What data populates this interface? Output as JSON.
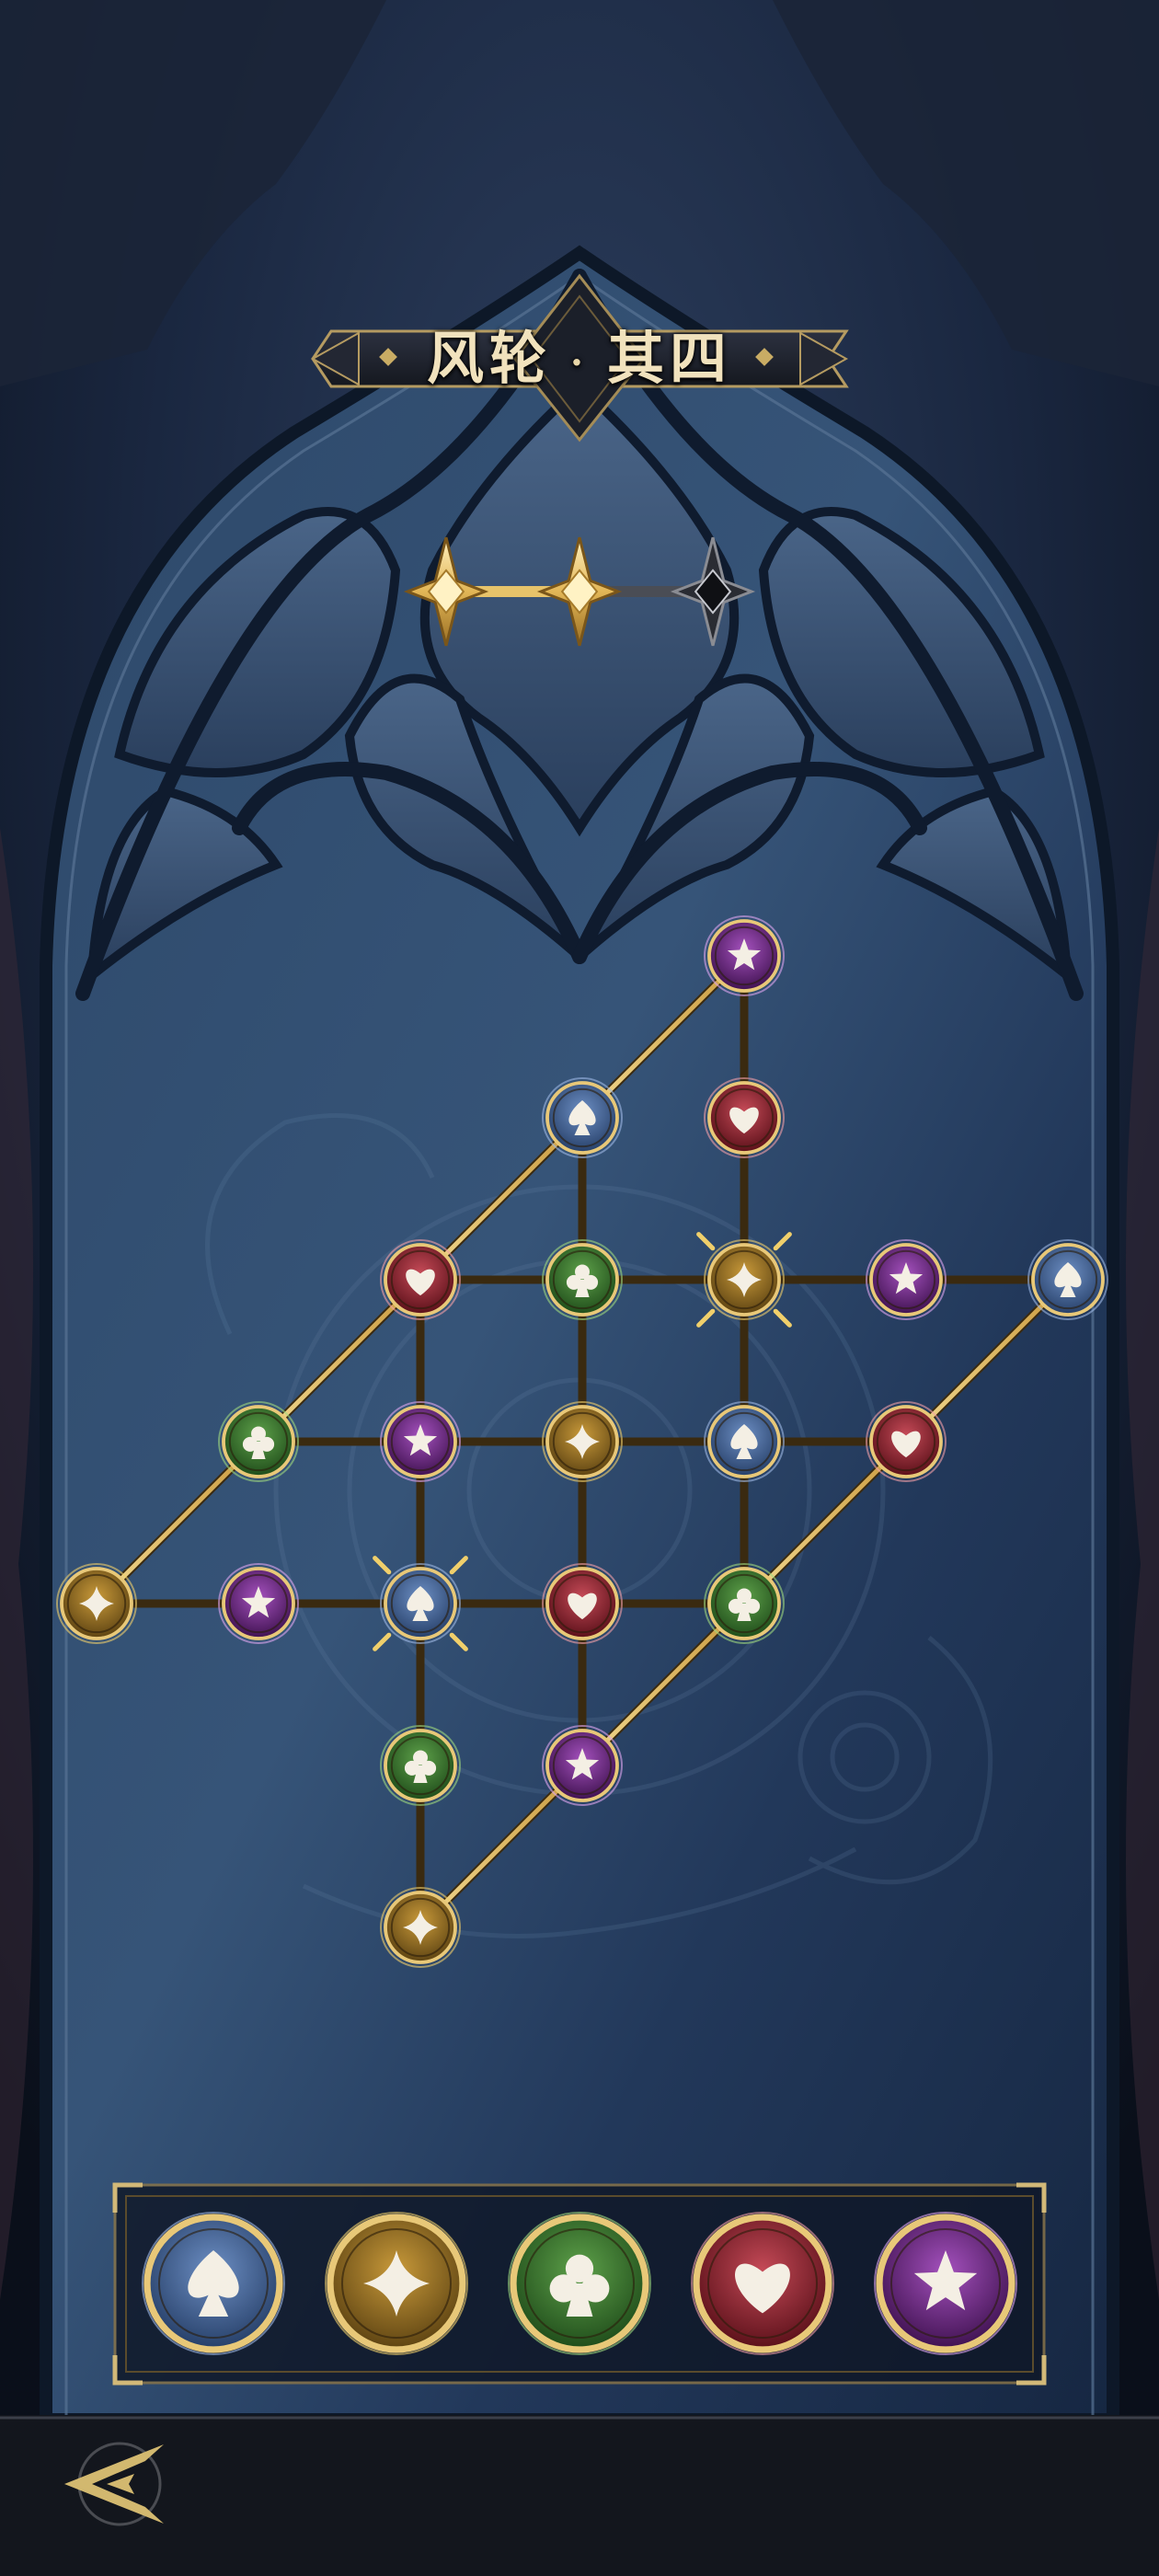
{
  "stage": {
    "title_main": "风轮",
    "title_sub": "其四",
    "title_separator": "·",
    "stars": {
      "total": 3,
      "earned": 2
    }
  },
  "suits": {
    "spade": {
      "icon": "spade-icon",
      "color": "#3b5d8f",
      "glow": "#9fb9e6"
    },
    "diamond": {
      "icon": "diamond-star-icon",
      "color": "#8e6a1b",
      "glow": "#f0cf6b"
    },
    "club": {
      "icon": "club-icon",
      "color": "#2f6a26",
      "glow": "#9fd87f"
    },
    "heart": {
      "icon": "heart-icon",
      "color": "#8f2230",
      "glow": "#f3a0a8"
    },
    "star": {
      "icon": "star-icon",
      "color": "#6a2580",
      "glow": "#e0a6f2"
    }
  },
  "grid": {
    "nodes": [
      {
        "id": "n1",
        "col": 4,
        "row": 0,
        "suit": "star"
      },
      {
        "id": "n2",
        "col": 3,
        "row": 1,
        "suit": "spade"
      },
      {
        "id": "n3",
        "col": 4,
        "row": 1,
        "suit": "heart"
      },
      {
        "id": "n4",
        "col": 2,
        "row": 2,
        "suit": "heart"
      },
      {
        "id": "n5",
        "col": 3,
        "row": 2,
        "suit": "club"
      },
      {
        "id": "n6",
        "col": 4,
        "row": 2,
        "suit": "diamond",
        "marked": true
      },
      {
        "id": "n7",
        "col": 5,
        "row": 2,
        "suit": "star"
      },
      {
        "id": "n8",
        "col": 6,
        "row": 2,
        "suit": "spade"
      },
      {
        "id": "n9",
        "col": 1,
        "row": 3,
        "suit": "club"
      },
      {
        "id": "n10",
        "col": 2,
        "row": 3,
        "suit": "star"
      },
      {
        "id": "n11",
        "col": 3,
        "row": 3,
        "suit": "diamond"
      },
      {
        "id": "n12",
        "col": 4,
        "row": 3,
        "suit": "spade"
      },
      {
        "id": "n13",
        "col": 5,
        "row": 3,
        "suit": "heart"
      },
      {
        "id": "n14",
        "col": 0,
        "row": 4,
        "suit": "diamond"
      },
      {
        "id": "n15",
        "col": 1,
        "row": 4,
        "suit": "star"
      },
      {
        "id": "n16",
        "col": 2,
        "row": 4,
        "suit": "spade",
        "marked": true
      },
      {
        "id": "n17",
        "col": 3,
        "row": 4,
        "suit": "heart"
      },
      {
        "id": "n18",
        "col": 4,
        "row": 4,
        "suit": "club"
      },
      {
        "id": "n19",
        "col": 2,
        "row": 5,
        "suit": "club"
      },
      {
        "id": "n20",
        "col": 3,
        "row": 5,
        "suit": "star"
      },
      {
        "id": "n21",
        "col": 2,
        "row": 6,
        "suit": "diamond"
      }
    ],
    "edges": [
      [
        "n1",
        "n2"
      ],
      [
        "n1",
        "n3"
      ],
      [
        "n2",
        "n4"
      ],
      [
        "n2",
        "n5"
      ],
      [
        "n3",
        "n6"
      ],
      [
        "n4",
        "n5"
      ],
      [
        "n5",
        "n6"
      ],
      [
        "n6",
        "n7"
      ],
      [
        "n7",
        "n8"
      ],
      [
        "n4",
        "n9"
      ],
      [
        "n4",
        "n10"
      ],
      [
        "n5",
        "n11"
      ],
      [
        "n6",
        "n12"
      ],
      [
        "n9",
        "n10"
      ],
      [
        "n10",
        "n11"
      ],
      [
        "n11",
        "n12"
      ],
      [
        "n12",
        "n13"
      ],
      [
        "n8",
        "n13"
      ],
      [
        "n9",
        "n14"
      ],
      [
        "n10",
        "n16"
      ],
      [
        "n11",
        "n17"
      ],
      [
        "n12",
        "n18"
      ],
      [
        "n13",
        "n18"
      ],
      [
        "n14",
        "n15"
      ],
      [
        "n15",
        "n16"
      ],
      [
        "n16",
        "n17"
      ],
      [
        "n17",
        "n18"
      ],
      [
        "n16",
        "n19"
      ],
      [
        "n17",
        "n20"
      ],
      [
        "n18",
        "n20"
      ],
      [
        "n19",
        "n21"
      ],
      [
        "n20",
        "n21"
      ]
    ]
  },
  "palette": [
    "spade",
    "diamond",
    "club",
    "heart",
    "star"
  ],
  "footer": {
    "back_icon": "back-arrow-icon"
  }
}
